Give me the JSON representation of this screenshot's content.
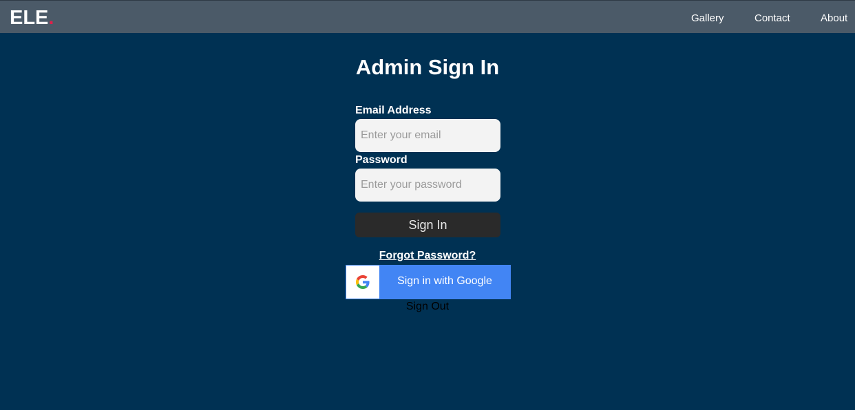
{
  "navbar": {
    "logo_text": "ELE",
    "logo_dot": ".",
    "links": [
      "Gallery",
      "Contact",
      "About"
    ]
  },
  "form": {
    "title": "Admin Sign In",
    "email_label": "Email Address",
    "email_placeholder": "Enter your email",
    "email_value": "",
    "password_label": "Password",
    "password_placeholder": "Enter your password",
    "password_value": "",
    "signin_label": "Sign In",
    "forgot_label": "Forgot Password?",
    "google_label": "Sign in with Google",
    "google_icon": "google-g-icon",
    "signout_label": "Sign Out"
  },
  "colors": {
    "page_background": "#003153",
    "navbar_background": "#4b5a68",
    "logo_dot": "#e0204a",
    "signin_button": "#2a2a2a",
    "google_button": "#4285f4"
  }
}
